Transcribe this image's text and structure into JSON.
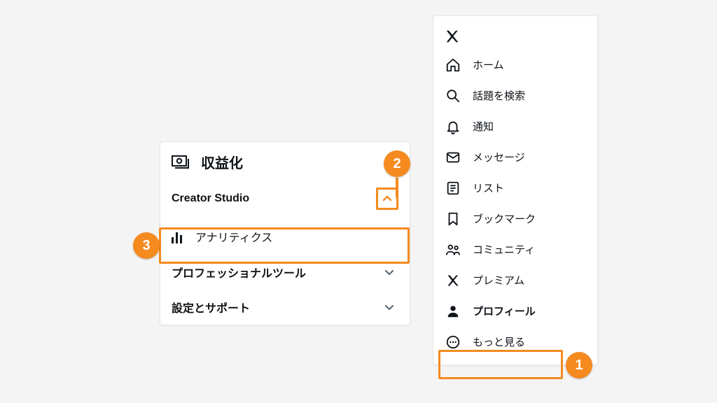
{
  "colors": {
    "highlight": "#f58a1f"
  },
  "sidebar": {
    "items": [
      {
        "key": "home",
        "label": "ホーム"
      },
      {
        "key": "explore",
        "label": "話題を検索"
      },
      {
        "key": "notifications",
        "label": "通知"
      },
      {
        "key": "messages",
        "label": "メッセージ"
      },
      {
        "key": "lists",
        "label": "リスト"
      },
      {
        "key": "bookmarks",
        "label": "ブックマーク"
      },
      {
        "key": "communities",
        "label": "コミュニティ"
      },
      {
        "key": "premium",
        "label": "プレミアム"
      },
      {
        "key": "profile",
        "label": "プロフィール"
      },
      {
        "key": "more",
        "label": "もっと見る"
      }
    ]
  },
  "submenu": {
    "header_label": "収益化",
    "sections": {
      "creator_studio": {
        "label": "Creator Studio",
        "expanded": true,
        "items": {
          "analytics": {
            "label": "アナリティクス"
          }
        }
      },
      "pro_tools": {
        "label": "プロフェッショナルツール",
        "expanded": false
      },
      "settings_support": {
        "label": "設定とサポート",
        "expanded": false
      }
    }
  },
  "annotations": {
    "badge1": "1",
    "badge2": "2",
    "badge3": "3"
  }
}
